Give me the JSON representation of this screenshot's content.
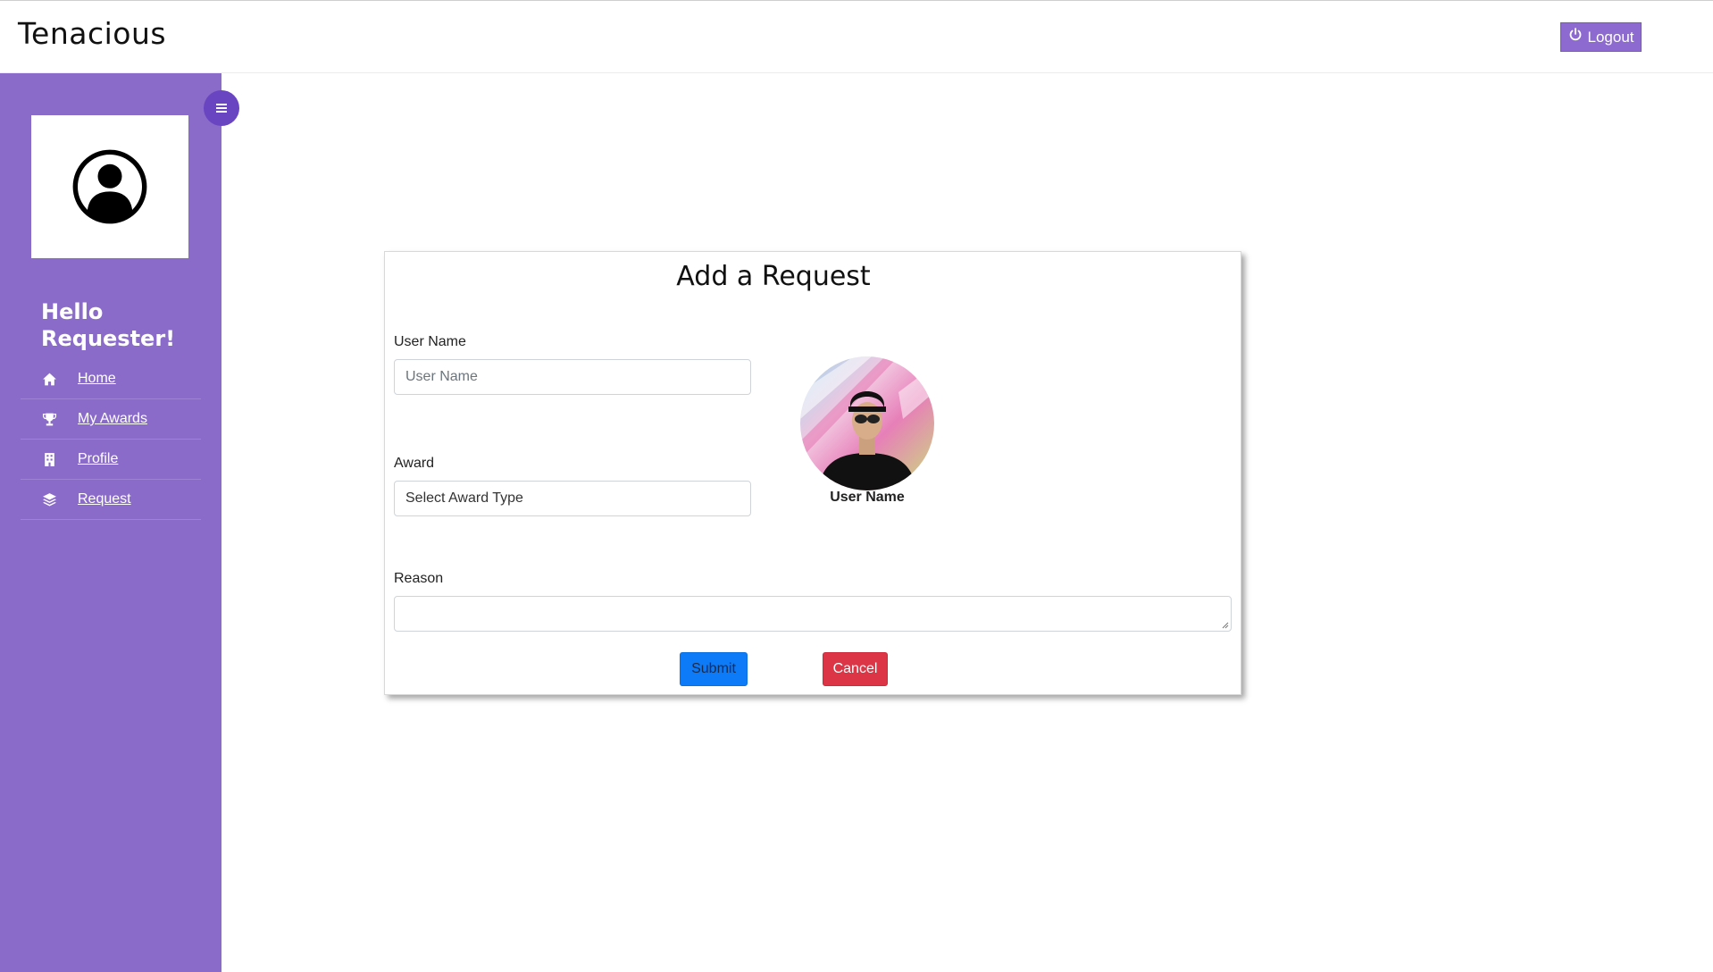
{
  "header": {
    "brand": "Tenacious",
    "logout_label": "Logout"
  },
  "sidebar": {
    "greeting": "Hello Requester!",
    "items": [
      {
        "label": "Home",
        "icon": "home-icon"
      },
      {
        "label": "My Awards",
        "icon": "trophy-icon"
      },
      {
        "label": "Profile",
        "icon": "building-icon"
      },
      {
        "label": "Request",
        "icon": "layers-icon"
      }
    ]
  },
  "form": {
    "title": "Add a Request",
    "username_label": "User Name",
    "username_placeholder": "User Name",
    "award_label": "Award",
    "award_selected": "Select Award Type",
    "reason_label": "Reason",
    "reason_value": "",
    "photo_caption": "User Name",
    "submit_label": "Submit",
    "cancel_label": "Cancel"
  },
  "colors": {
    "sidebar": "#8a6bc9",
    "toggle": "#6a45c2",
    "logout": "#8d6ad0",
    "submit": "#0d7bf7",
    "cancel": "#dc3545"
  }
}
